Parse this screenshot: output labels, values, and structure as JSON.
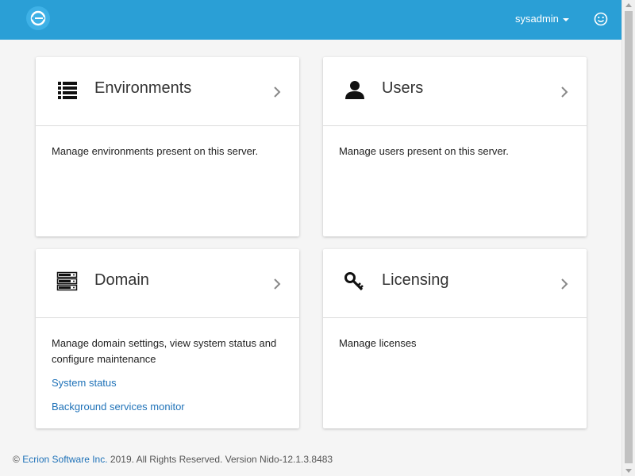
{
  "header": {
    "username": "sysadmin",
    "brand_color": "#2a9fd6"
  },
  "cards": [
    {
      "title": "Environments",
      "description": "Manage environments present on this server.",
      "icon": "list-icon"
    },
    {
      "title": "Users",
      "description": "Manage users present on this server.",
      "icon": "user-icon"
    },
    {
      "title": "Domain",
      "description": "Manage domain settings, view system status and configure maintenance",
      "icon": "server-icon",
      "links": [
        "System status",
        "Background services monitor"
      ]
    },
    {
      "title": "Licensing",
      "description": "Manage licenses",
      "icon": "key-icon"
    }
  ],
  "footer": {
    "copyright_symbol": "©",
    "company_link": "Ecrion Software Inc.",
    "rest": "2019. All Rights Reserved. Version Nido-12.1.3.8483"
  }
}
